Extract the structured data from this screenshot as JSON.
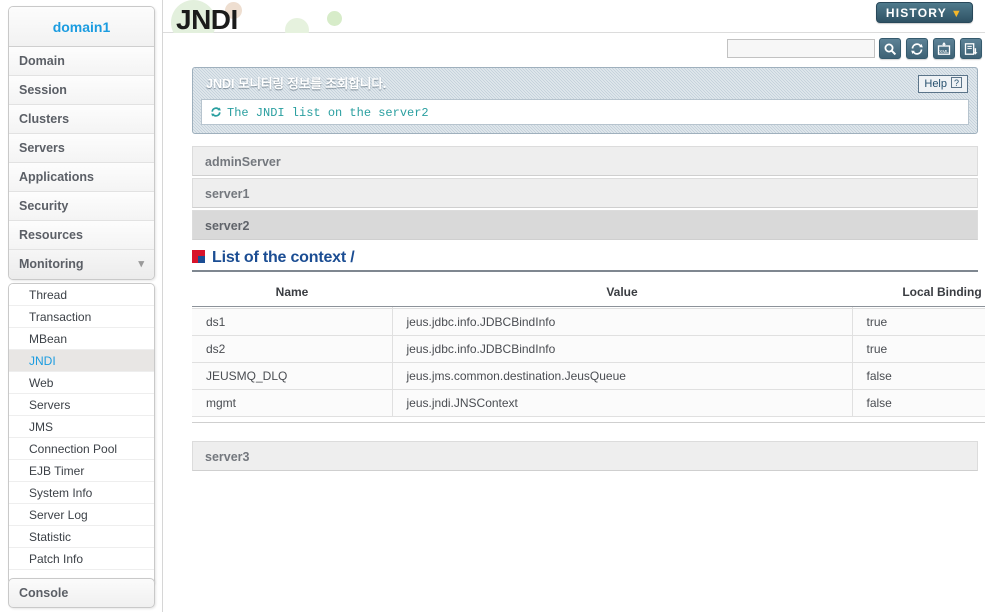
{
  "sidebar": {
    "domain_title": "domain1",
    "items": [
      {
        "label": "Domain"
      },
      {
        "label": "Session"
      },
      {
        "label": "Clusters"
      },
      {
        "label": "Servers"
      },
      {
        "label": "Applications"
      },
      {
        "label": "Security"
      },
      {
        "label": "Resources"
      },
      {
        "label": "Monitoring",
        "expanded": true,
        "chevron": "chevron-down-icon"
      }
    ],
    "submenu": [
      {
        "label": "Thread"
      },
      {
        "label": "Transaction"
      },
      {
        "label": "MBean"
      },
      {
        "label": "JNDI",
        "active": true
      },
      {
        "label": "Web"
      },
      {
        "label": "Servers"
      },
      {
        "label": "JMS"
      },
      {
        "label": "Connection Pool"
      },
      {
        "label": "EJB Timer"
      },
      {
        "label": "System Info"
      },
      {
        "label": "Server Log"
      },
      {
        "label": "Statistic"
      },
      {
        "label": "Patch Info"
      }
    ],
    "console_label": "Console"
  },
  "header": {
    "logo": "JNDI",
    "history_label": "HISTORY",
    "history_chevron": "chevron-down-icon"
  },
  "toolbar": {
    "search_value": "",
    "search_placeholder": "",
    "buttons": [
      {
        "name": "search-icon",
        "title": "Search"
      },
      {
        "name": "refresh-icon",
        "title": "Refresh"
      },
      {
        "name": "xml-export-icon",
        "title": "XML"
      },
      {
        "name": "export-icon",
        "title": "Export"
      }
    ]
  },
  "banner": {
    "title": "JNDI 모니터링 정보를 조회합니다.",
    "help_label": "Help",
    "help_mark": "?",
    "message": "The JNDI list on the server2",
    "message_icon": "refresh-icon"
  },
  "servers": [
    {
      "name": "adminServer",
      "selected": false
    },
    {
      "name": "server1",
      "selected": false
    },
    {
      "name": "server2",
      "selected": true
    },
    {
      "name": "server3",
      "selected": false
    }
  ],
  "section": {
    "title": "List of the context /",
    "icon": "context-square-icon"
  },
  "table": {
    "columns": [
      "Name",
      "Value",
      "Local Binding"
    ],
    "rows": [
      {
        "name": "ds1",
        "value": "jeus.jdbc.info.JDBCBindInfo",
        "local_binding": "true"
      },
      {
        "name": "ds2",
        "value": "jeus.jdbc.info.JDBCBindInfo",
        "local_binding": "true"
      },
      {
        "name": "JEUSMQ_DLQ",
        "value": "jeus.jms.common.destination.JeusQueue",
        "local_binding": "false"
      },
      {
        "name": "mgmt",
        "value": "jeus.jndi.JNSContext",
        "local_binding": "false"
      }
    ]
  },
  "colors": {
    "accent_blue": "#1b9ce0",
    "section_blue": "#1b4d93",
    "banner_bg": "#c6d2dc",
    "history_bg": "#2f5264",
    "history_chevron": "#f5b729",
    "message_teal": "#2a9fa0",
    "icon_red": "#d8132a"
  }
}
